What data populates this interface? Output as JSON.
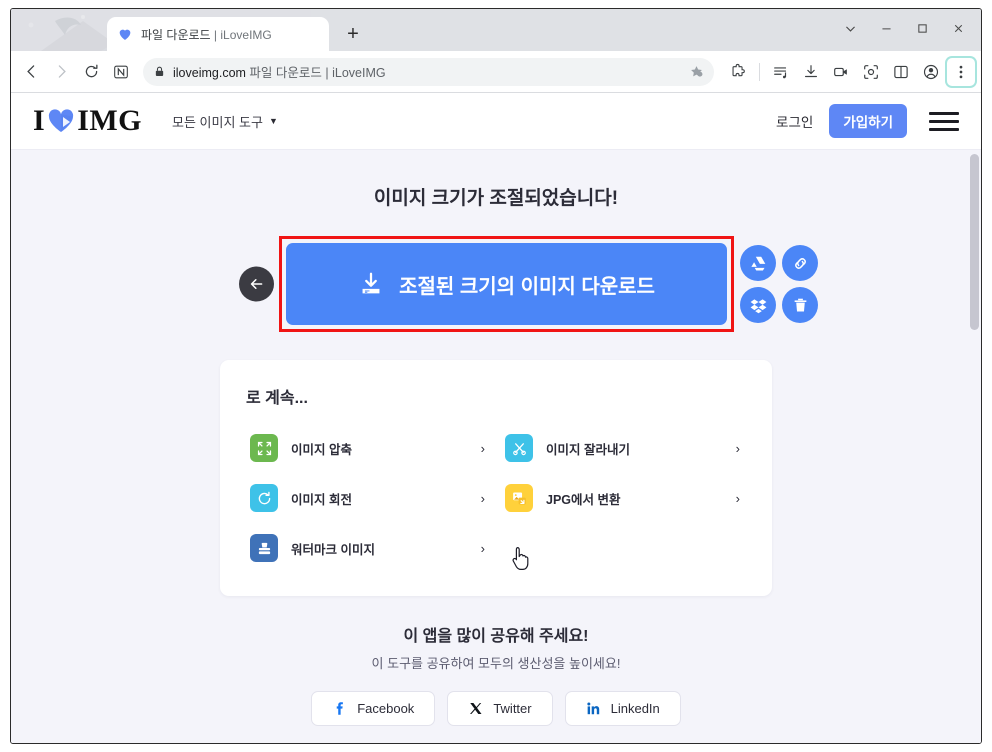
{
  "browser": {
    "tab": {
      "title_main": "파일 다운로드",
      "title_sep": " | ",
      "title_site": "iLoveIMG",
      "favicon": "heart-icon"
    },
    "newtab_label": "+",
    "window_controls": [
      {
        "name": "chevron-down",
        "label": "⌄"
      },
      {
        "name": "minimize",
        "label": "—"
      },
      {
        "name": "maximize",
        "label": "□"
      },
      {
        "name": "close",
        "label": "✕"
      }
    ],
    "nav": {
      "back": "back-arrow-icon",
      "forward": "forward-arrow-icon",
      "reload": "reload-icon",
      "naver_button": "N"
    },
    "omnibox": {
      "lock": "lock-icon",
      "domain": "iloveimg.com",
      "page_title": "파일 다운로드 | iLoveIMG",
      "bookmark": "star-icon"
    },
    "toolbar_icons": [
      "extensions-puzzle-icon",
      "playlist-music-icon",
      "downloads-icon",
      "video-capture-icon",
      "screenshot-icon",
      "split-view-icon",
      "profile-avatar-icon",
      "three-dot-menu-icon"
    ]
  },
  "site": {
    "logo": {
      "left": "I",
      "right": "IMG",
      "heart": "heart-icon"
    },
    "nav_tools_label": "모든 이미지 도구",
    "login_label": "로그인",
    "signup_label": "가입하기",
    "menu": "hamburger-icon"
  },
  "result": {
    "heading": "이미지 크기가 조절되었습니다!",
    "download_label": "조절된 크기의 이미지 다운로드",
    "back_button": "back-arrow-icon",
    "side_actions": [
      {
        "name": "google-drive",
        "icon": "google-drive-icon"
      },
      {
        "name": "copy-link",
        "icon": "link-icon"
      },
      {
        "name": "dropbox",
        "icon": "dropbox-icon"
      },
      {
        "name": "delete",
        "icon": "trash-icon"
      }
    ]
  },
  "continue": {
    "title": "로 계속...",
    "tools": [
      {
        "label": "이미지 압축",
        "icon": "compress-icon",
        "color": "#6cb84f",
        "bg": "#6cb84f"
      },
      {
        "label": "이미지 잘라내기",
        "icon": "scissors-icon",
        "color": "#3ec2e8",
        "bg": "#3ec2e8"
      },
      {
        "label": "이미지 회전",
        "icon": "rotate-icon",
        "color": "#3ec2e8",
        "bg": "#3ec2e8"
      },
      {
        "label": "JPG에서 변환",
        "icon": "convert-image-icon",
        "color": "#ffd13b",
        "bg": "#ffd13b"
      },
      {
        "label": "워터마크 이미지",
        "icon": "stamp-icon",
        "color": "#3f72b8",
        "bg": "#3f72b8"
      }
    ],
    "chevron": "›"
  },
  "share": {
    "title": "이 앱을 많이 공유해 주세요!",
    "subtitle": "이 도구를 공유하여 모두의 생산성을 높이세요!",
    "buttons": [
      {
        "label": "Facebook",
        "icon": "facebook-icon",
        "color": "#1877f2"
      },
      {
        "label": "Twitter",
        "icon": "twitter-x-icon",
        "color": "#0f1419"
      },
      {
        "label": "LinkedIn",
        "icon": "linkedin-icon",
        "color": "#0a66c2"
      }
    ]
  },
  "colors": {
    "accent_blue": "#4b86f7",
    "signup_blue": "#5e87f5",
    "highlight_red": "#f01414",
    "page_bg": "#f4f4fa"
  }
}
